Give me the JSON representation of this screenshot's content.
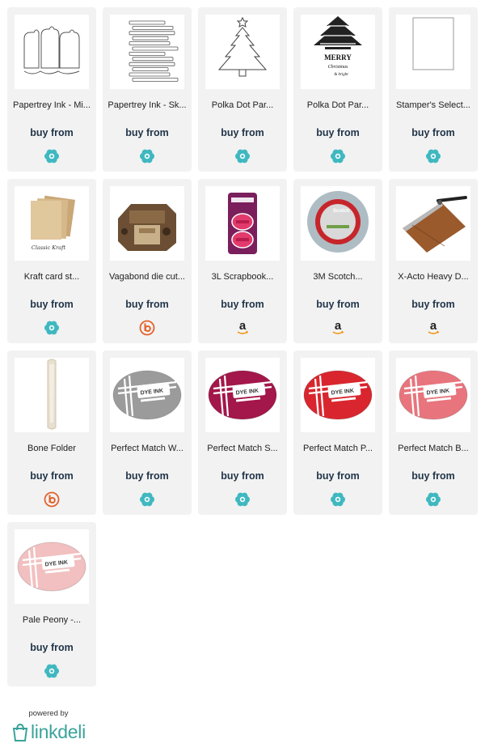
{
  "cta_label": "buy from",
  "products": [
    {
      "title": "Papertrey Ink - Mi...",
      "thumb": "tag-die-icon",
      "store": "flower-icon"
    },
    {
      "title": "Papertrey Ink - Sk...",
      "thumb": "strip-die-icon",
      "store": "flower-icon"
    },
    {
      "title": "Polka Dot Par...",
      "thumb": "tree-die-icon",
      "store": "flower-icon"
    },
    {
      "title": "Polka Dot Par...",
      "thumb": "stamp-set-icon",
      "store": "flower-icon"
    },
    {
      "title": "Stamper's Select...",
      "thumb": "white-card-icon",
      "store": "flower-icon"
    },
    {
      "title": "Kraft card st...",
      "thumb": "kraft-cardstock-icon",
      "store": "flower-icon"
    },
    {
      "title": "Vagabond die cut...",
      "thumb": "die-machine-icon",
      "store": "blick-icon"
    },
    {
      "title": "3L Scrapbook...",
      "thumb": "adhesive-pack-icon",
      "store": "amazon-icon"
    },
    {
      "title": "3M Scotch...",
      "thumb": "foam-tape-icon",
      "store": "amazon-icon"
    },
    {
      "title": "X-Acto Heavy D...",
      "thumb": "paper-trimmer-icon",
      "store": "amazon-icon"
    },
    {
      "title": "Bone Folder",
      "thumb": "bone-folder-icon",
      "store": "blick-icon"
    },
    {
      "title": "Perfect Match W...",
      "thumb": "ink-pad-icon",
      "store": "flower-icon",
      "ink_color": "#9b9b9b"
    },
    {
      "title": "Perfect Match S...",
      "thumb": "ink-pad-icon",
      "store": "flower-icon",
      "ink_color": "#a3174a"
    },
    {
      "title": "Perfect Match P...",
      "thumb": "ink-pad-icon",
      "store": "flower-icon",
      "ink_color": "#d9262e"
    },
    {
      "title": "Perfect Match B...",
      "thumb": "ink-pad-icon",
      "store": "flower-icon",
      "ink_color": "#e8757d"
    },
    {
      "title": "Pale Peony -...",
      "thumb": "ink-pad-icon",
      "store": "flower-icon",
      "ink_color": "#f2c0c0"
    }
  ],
  "stamp_text": {
    "line1": "MERRY",
    "line2": "Christmas",
    "line3": "& bright"
  },
  "kraft_label": "Classic Kraft",
  "ink_label": "DYE INK",
  "scotch_label": "Scotch",
  "footer": {
    "powered_by": "powered by",
    "logo_text": "linkdeli"
  },
  "colors": {
    "flower": "#3fb8c0",
    "blick": "#e2622a",
    "amazon": "#222222",
    "cta": "#1f3348"
  }
}
